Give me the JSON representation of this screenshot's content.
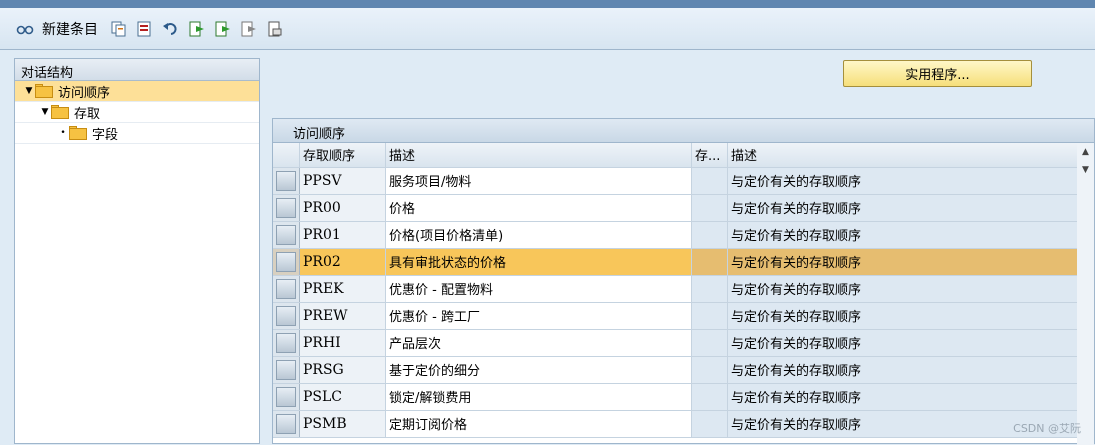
{
  "toolbar": {
    "new_entries_label": "新建条目",
    "icons": [
      "glasses-icon",
      "copy-icon",
      "delete-icon",
      "undo-icon",
      "export-icon",
      "export2-icon",
      "export3-icon",
      "print-icon"
    ]
  },
  "sidebar": {
    "title": "对话结构",
    "items": [
      {
        "label": "访问顺序",
        "level": 0
      },
      {
        "label": "存取",
        "level": 1
      },
      {
        "label": "字段",
        "level": 2
      }
    ]
  },
  "utility_button": "实用程序...",
  "panel": {
    "title": "访问顺序",
    "columns": [
      "存取顺序",
      "描述",
      "存...",
      "描述"
    ],
    "rows": [
      {
        "code": "PPSV",
        "desc": "服务项目/物料",
        "desc2": "与定价有关的存取顺序"
      },
      {
        "code": "PR00",
        "desc": "价格",
        "desc2": "与定价有关的存取顺序"
      },
      {
        "code": "PR01",
        "desc": "价格(项目价格清单)",
        "desc2": "与定价有关的存取顺序"
      },
      {
        "code": "PR02",
        "desc": "具有审批状态的价格",
        "desc2": "与定价有关的存取顺序"
      },
      {
        "code": "PREK",
        "desc": "优惠价 - 配置物料",
        "desc2": "与定价有关的存取顺序"
      },
      {
        "code": "PREW",
        "desc": "优惠价 - 跨工厂",
        "desc2": "与定价有关的存取顺序"
      },
      {
        "code": "PRHI",
        "desc": "产品层次",
        "desc2": "与定价有关的存取顺序"
      },
      {
        "code": "PRSG",
        "desc": "基于定价的细分",
        "desc2": "与定价有关的存取顺序"
      },
      {
        "code": "PSLC",
        "desc": "锁定/解锁费用",
        "desc2": "与定价有关的存取顺序"
      },
      {
        "code": "PSMB",
        "desc": "定期订阅价格",
        "desc2": "与定价有关的存取顺序"
      }
    ]
  },
  "watermark": "CSDN @艾阮"
}
